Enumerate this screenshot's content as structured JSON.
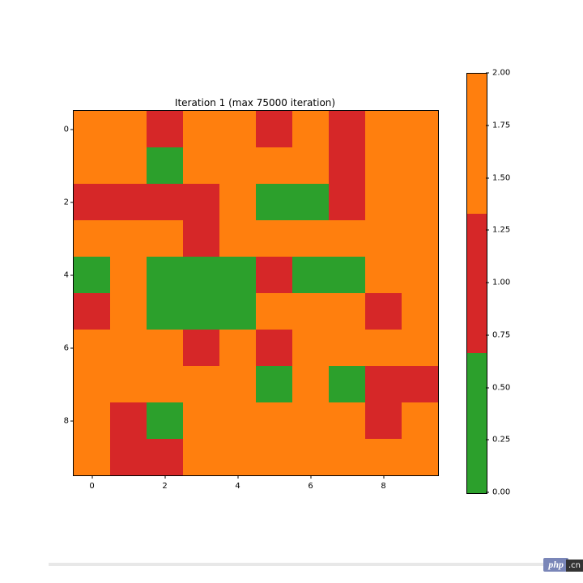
{
  "chart_data": {
    "type": "heatmap",
    "title": "Iteration 1 (max 75000 iteration)",
    "x_ticks": [
      0,
      2,
      4,
      6,
      8
    ],
    "y_ticks": [
      0,
      2,
      4,
      6,
      8
    ],
    "xlim": [
      -0.5,
      9.5
    ],
    "ylim": [
      -0.5,
      9.5
    ],
    "grid": [
      [
        2,
        2,
        1,
        2,
        2,
        1,
        2,
        1,
        2,
        2
      ],
      [
        2,
        2,
        0,
        2,
        2,
        2,
        2,
        1,
        2,
        2
      ],
      [
        1,
        1,
        1,
        1,
        2,
        0,
        0,
        1,
        2,
        2
      ],
      [
        2,
        2,
        2,
        1,
        2,
        2,
        2,
        2,
        2,
        2
      ],
      [
        0,
        2,
        0,
        0,
        0,
        1,
        0,
        0,
        2,
        2
      ],
      [
        1,
        2,
        0,
        0,
        0,
        2,
        2,
        2,
        1,
        2
      ],
      [
        2,
        2,
        2,
        1,
        2,
        1,
        2,
        2,
        2,
        2
      ],
      [
        2,
        2,
        2,
        2,
        2,
        0,
        2,
        0,
        1,
        1
      ],
      [
        2,
        1,
        0,
        2,
        2,
        2,
        2,
        2,
        1,
        2
      ],
      [
        2,
        1,
        1,
        2,
        2,
        2,
        2,
        2,
        2,
        2
      ]
    ],
    "colorbar": {
      "ticks": [
        0.0,
        0.25,
        0.5,
        0.75,
        1.0,
        1.25,
        1.5,
        1.75,
        2.0
      ],
      "range": [
        0.0,
        2.0
      ],
      "segments": [
        {
          "value": 0,
          "color": "#2ca02c"
        },
        {
          "value": 1,
          "color": "#d62728"
        },
        {
          "value": 2,
          "color": "#ff7f0e"
        }
      ]
    }
  },
  "badge": {
    "php": "php",
    "cn": ".cn"
  }
}
